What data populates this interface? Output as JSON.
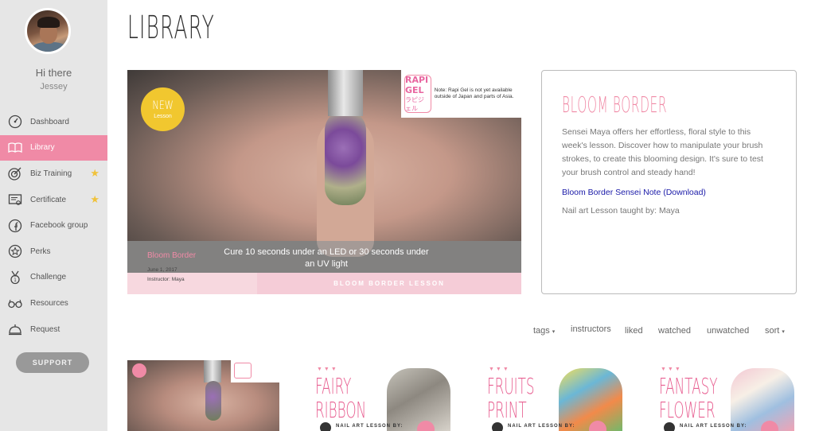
{
  "sidebar": {
    "greeting": "Hi there",
    "user_name": "Jessey",
    "items": [
      {
        "label": "Dashboard",
        "icon": "dashboard-icon",
        "active": false,
        "starred": false
      },
      {
        "label": "Library",
        "icon": "book-icon",
        "active": true,
        "starred": false
      },
      {
        "label": "Biz Training",
        "icon": "target-icon",
        "active": false,
        "starred": true
      },
      {
        "label": "Certificate",
        "icon": "certificate-icon",
        "active": false,
        "starred": true
      },
      {
        "label": "Facebook group",
        "icon": "facebook-icon",
        "active": false,
        "starred": false
      },
      {
        "label": "Perks",
        "icon": "star-badge-icon",
        "active": false,
        "starred": false
      },
      {
        "label": "Challenge",
        "icon": "medal-icon",
        "active": false,
        "starred": false
      },
      {
        "label": "Resources",
        "icon": "glasses-icon",
        "active": false,
        "starred": false
      },
      {
        "label": "Request",
        "icon": "bell-icon",
        "active": false,
        "starred": false
      }
    ],
    "support_label": "SUPPORT",
    "star_glyph": "★"
  },
  "main": {
    "title": "LIBRARY",
    "hero": {
      "badge_title": "NEW",
      "badge_sub": "Lesson",
      "logo_line1": "RAPI GEL",
      "logo_line2": "ラピジェル",
      "note": "Note: Rapi Gel is not yet available outside of Japan and parts of Asia.",
      "overlay_text": "Cure 10 seconds under an LED or 30 seconds under an UV light",
      "lesson_name": "Bloom Border",
      "lesson_date": "June 1, 2017",
      "lesson_instructor": "Instructor: Maya",
      "bar_label": "BLOOM BORDER LESSON"
    },
    "info": {
      "title": "BLOOM BORDER",
      "description": "Sensei Maya offers her effortless, floral style to this week's lesson.  Discover how to manipulate your brush strokes, to create this blooming design. It's sure to test your brush control and steady hand!",
      "link": "Bloom Border Sensei Note (Download)",
      "teacher": "Nail art Lesson taught by: Maya"
    },
    "filters": {
      "tags": "tags",
      "instructors": "instructors",
      "liked": "liked",
      "watched": "watched",
      "unwatched": "unwatched",
      "sort": "sort",
      "caret": "▾"
    },
    "thumbnails": [
      {
        "title": "",
        "sub": ""
      },
      {
        "title": "FAIRY\nRIBBON",
        "sub": "NAIL ART LESSON BY:",
        "dots": "▼▼▼"
      },
      {
        "title": "FRUITS\nPRINT",
        "sub": "NAIL ART LESSON BY:",
        "dots": "▼▼▼"
      },
      {
        "title": "FANTASY\nFLOWER",
        "sub": "NAIL ART LESSON BY:",
        "dots": "▼▼▼"
      }
    ]
  },
  "colors": {
    "accent_pink": "#f08aa6",
    "badge_yellow": "#f1c72f",
    "link_blue": "#1a1aa8",
    "sidebar_bg": "#e6e6e6"
  }
}
